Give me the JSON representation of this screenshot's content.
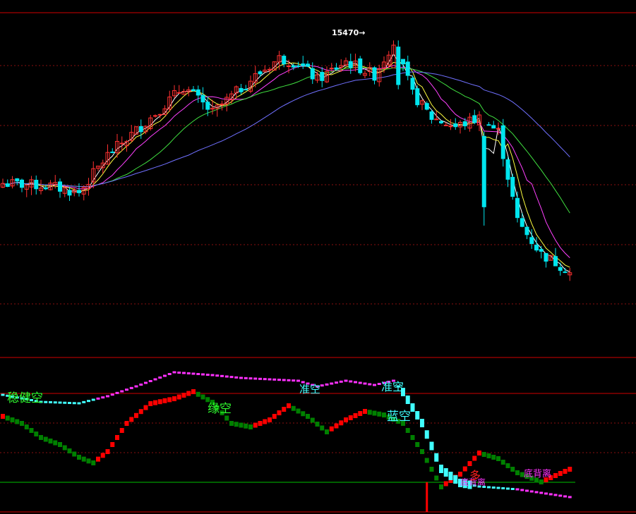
{
  "colors": {
    "background": "#000000",
    "frame": "#d00000",
    "gridline": "#8a1010",
    "candle_up": "#ff3030",
    "candle_down": "#00e5ee",
    "ma_fast": "#ffffff",
    "ma_5": "#ffff40",
    "ma_10": "#ff40ff",
    "ma_20": "#40e040",
    "ma_60": "#7070ff",
    "bar_red": "#ff0000",
    "bar_green": "#008000",
    "dot_magenta": "#ff30ff",
    "dot_cyan": "#40ffff",
    "zero_line": "#00c000",
    "label_green": "#30ff30",
    "label_cyan": "#40ffff",
    "label_magenta": "#ff30ff",
    "label_red": "#ff2020"
  },
  "chart_data": [
    {
      "type": "candlestick",
      "title": "",
      "peak_label": "15470→",
      "peak_value": 15470,
      "grid": true,
      "legend": "none",
      "candles": [],
      "series": [
        {
          "values": []
        },
        {
          "values": []
        },
        {
          "values": []
        },
        {
          "values": []
        },
        {
          "values": []
        }
      ]
    },
    {
      "type": "bar",
      "title": "",
      "grid": true,
      "bars": [],
      "dots": [],
      "annotations": [
        {
          "text": "稳健空"
        },
        {
          "text": "缘空"
        },
        {
          "text": "准空"
        },
        {
          "text": "准空"
        },
        {
          "text": "蓝空"
        },
        {
          "text": "底背离"
        },
        {
          "text": "底背离"
        },
        {
          "text": "多"
        }
      ]
    }
  ]
}
